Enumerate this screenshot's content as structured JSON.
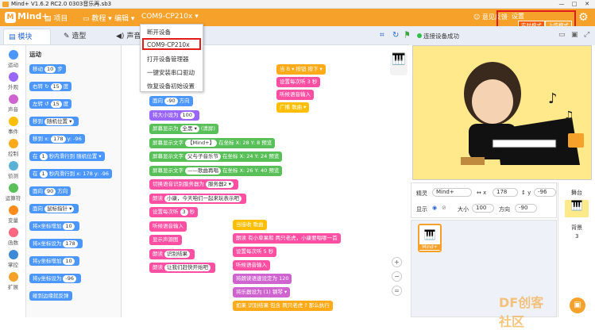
{
  "window": {
    "title": "Mind+ V1.6.2 RC2.0   0303音乐再.sb3",
    "minimize": "—",
    "maximize": "□",
    "close": "✕"
  },
  "menubar": {
    "logo": "Mind+",
    "items": [
      "项目",
      "教程",
      "编辑",
      "COM9-CP210x"
    ],
    "right": {
      "feedback": "意见反馈",
      "settings": "设置",
      "realtime_mode": "实时模式",
      "upload_mode": "上传模式"
    }
  },
  "device_menu": {
    "items": [
      "断开设备",
      "COM9-CP210x",
      "打开设备管理器",
      "一键安装串口驱动",
      "恢复设备初始设置"
    ]
  },
  "tabs": [
    {
      "label": "模块"
    },
    {
      "label": "造型"
    },
    {
      "label": "声音"
    }
  ],
  "connection_status": "连接设备成功",
  "categories": [
    {
      "label": "运动",
      "color": "#4c97ff"
    },
    {
      "label": "外观",
      "color": "#9966ff"
    },
    {
      "label": "声音",
      "color": "#cf63cf"
    },
    {
      "label": "事件",
      "color": "#ffbf00"
    },
    {
      "label": "控制",
      "color": "#ffab19"
    },
    {
      "label": "侦测",
      "color": "#5cb1d6"
    },
    {
      "label": "运算符",
      "color": "#59c059"
    },
    {
      "label": "变量",
      "color": "#ff8c1a"
    },
    {
      "label": "函数",
      "color": "#ff6680"
    },
    {
      "label": "掌控",
      "color": "#3d8bd6"
    },
    {
      "label": "扩展",
      "color": "#f5a12a"
    }
  ],
  "palette": {
    "heading": "运动",
    "blocks": [
      {
        "text": "移动",
        "val": "10",
        "suffix": "步"
      },
      {
        "text": "右转 ↻",
        "val": "15",
        "suffix": "度"
      },
      {
        "text": "左转 ↺",
        "val": "15",
        "suffix": "度"
      },
      {
        "text": "移到",
        "val": "随机位置 ▾",
        "suffix": ""
      },
      {
        "text": "移到 x:",
        "val": "178",
        "suffix": "y: -96"
      },
      {
        "text": "在",
        "val": "1",
        "suffix": "秒内滑行到 随机位置 ▾"
      },
      {
        "text": "在",
        "val": "1",
        "suffix": "秒内滑行到 x: 178 y: -96"
      },
      {
        "text": "面向",
        "val": "90",
        "suffix": "方向"
      },
      {
        "text": "面向",
        "val": "鼠标指针 ▾",
        "suffix": ""
      },
      {
        "text": "将x坐标增加",
        "val": "10",
        "suffix": ""
      },
      {
        "text": "将x坐标设为",
        "val": "178",
        "suffix": ""
      },
      {
        "text": "将y坐标增加",
        "val": "10",
        "suffix": ""
      },
      {
        "text": "将y坐标设为",
        "val": "-96",
        "suffix": ""
      },
      {
        "text": "碰到边缘就反弹",
        "val": "",
        "suffix": ""
      }
    ]
  },
  "script1": [
    {
      "text": "面向",
      "val": "-90",
      "suffix": "方向",
      "color": "#4c97ff"
    },
    {
      "text": "将大小设为",
      "val": "100",
      "suffix": "",
      "color": "#9966ff"
    },
    {
      "text": "屏幕显示为",
      "val": "全黑 ▾",
      "suffix": "(清屏)",
      "color": "#59c059"
    },
    {
      "text": "屏幕显示文字",
      "val": "【Mind+】",
      "suffix": "在坐标 X: 28 Y: 8 预览",
      "color": "#59c059"
    },
    {
      "text": "屏幕显示文字",
      "val": "父与子音乐节",
      "suffix": "在坐标 X: 24 Y: 24 预览",
      "color": "#59c059"
    },
    {
      "text": "屏幕显示文字",
      "val": "——歌曲再唱",
      "suffix": "在坐标 X: 26 Y: 40 预览",
      "color": "#59c059"
    },
    {
      "text": "切换语音识别服务器为",
      "val": "服务器2 ▾",
      "suffix": "",
      "color": "#ff4fa3"
    },
    {
      "text": "朗读",
      "val": "小康，今天咱们一起来玩表示吧",
      "suffix": "",
      "color": "#ff4fa3"
    },
    {
      "text": "设置每次听",
      "val": "3",
      "suffix": "秒",
      "color": "#ff4fa3"
    },
    {
      "text": "听候语音输入",
      "val": "",
      "suffix": "",
      "color": "#ff4fa3"
    },
    {
      "text": "显示",
      "val": "",
      "suffix": "声源图",
      "color": "#ff4fa3"
    },
    {
      "text": "朗读",
      "val": "识别结果",
      "suffix": "",
      "color": "#ff4fa3"
    },
    {
      "text": "朗读",
      "val": "让我们赶快开始吧",
      "suffix": "",
      "color": "#ff4fa3"
    }
  ],
  "script2": [
    {
      "text": "当 B ▾ 按钮 按下 ▾",
      "color": "#ffab19"
    },
    {
      "text": "设置每次听 3 秒",
      "color": "#ff4fa3"
    },
    {
      "text": "听候语音输入",
      "color": "#ff4fa3"
    },
    {
      "text": "广播 歌曲 ▾",
      "color": "#ffbf00"
    }
  ],
  "script3": [
    {
      "text": "当接收 歌曲",
      "color": "#ffbf00"
    },
    {
      "text": "朗读 有小草果和 两只老虎，小康要唱哪一首",
      "color": "#ff4fa3"
    },
    {
      "text": "设置每次听 5 秒",
      "color": "#ff4fa3"
    },
    {
      "text": "听候语音输入",
      "color": "#ff4fa3"
    },
    {
      "text": "将朗读语速设定为 120",
      "color": "#cf63cf"
    },
    {
      "text": "将乐器设为 (1) 钢琴 ▾",
      "color": "#cf63cf"
    },
    {
      "text": "如果 识别结果 包含 两只老虎 ? 那么执行",
      "color": "#ffab19"
    }
  ],
  "sprite": {
    "label_sprite": "精灵",
    "name": "Mind+",
    "x_label": "x",
    "x": "178",
    "y_label": "y",
    "y": "-96",
    "show_label": "显示",
    "size_label": "大小",
    "size": "100",
    "direction_label": "方向",
    "direction": "-90",
    "thumb_label": "Mind+"
  },
  "stage_panel": {
    "label": "舞台",
    "backdrop_label": "背景",
    "backdrop_count": "3"
  },
  "colors": {
    "accent": "#f5a12a",
    "highlight": "#e21b1b",
    "stage_bg": "#ffe98a"
  }
}
